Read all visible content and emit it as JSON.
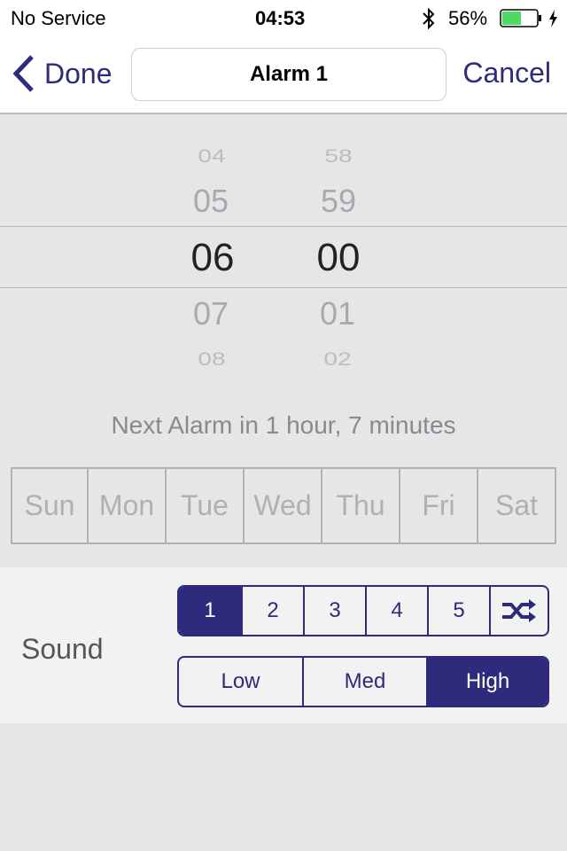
{
  "status": {
    "carrier": "No Service",
    "time": "04:53",
    "battery": "56%",
    "battery_level": 0.56
  },
  "nav": {
    "back_label": "Done",
    "title": "Alarm 1",
    "cancel_label": "Cancel"
  },
  "picker": {
    "hours": [
      "04",
      "05",
      "06",
      "07",
      "08"
    ],
    "minutes": [
      "58",
      "59",
      "00",
      "01",
      "02"
    ],
    "selected_hour": "06",
    "selected_minute": "00"
  },
  "next_alarm": "Next Alarm in 1 hour, 7 minutes",
  "days": [
    "Sun",
    "Mon",
    "Tue",
    "Wed",
    "Thu",
    "Fri",
    "Sat"
  ],
  "sound": {
    "label": "Sound",
    "tracks": [
      "1",
      "2",
      "3",
      "4",
      "5"
    ],
    "selected_track": "1",
    "shuffle_icon": "shuffle-icon",
    "volumes": [
      "Low",
      "Med",
      "High"
    ],
    "selected_volume": "High"
  },
  "colors": {
    "accent": "#2e2a7c",
    "battery": "#4cd964"
  }
}
